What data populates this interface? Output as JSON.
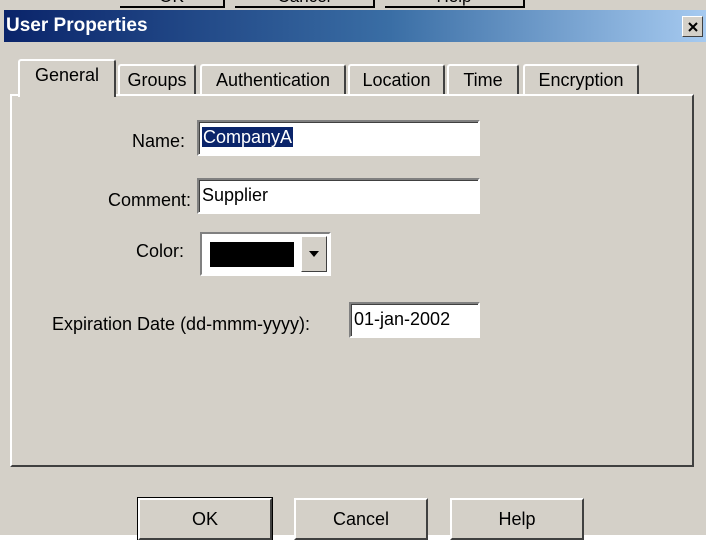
{
  "background_buttons": [
    "OK",
    "Cancel",
    "Help"
  ],
  "window": {
    "title": "User Properties",
    "close_glyph": "close-icon"
  },
  "tabs": [
    {
      "label": "General",
      "active": true
    },
    {
      "label": "Groups",
      "active": false
    },
    {
      "label": "Authentication",
      "active": false
    },
    {
      "label": "Location",
      "active": false
    },
    {
      "label": "Time",
      "active": false
    },
    {
      "label": "Encryption",
      "active": false
    }
  ],
  "form": {
    "name_label": "Name:",
    "name_value": "CompanyA",
    "comment_label": "Comment:",
    "comment_value": "Supplier",
    "color_label": "Color:",
    "color_value": "#000000",
    "expiration_label": "Expiration Date (dd-mmm-yyyy):",
    "expiration_value": "01-jan-2002"
  },
  "buttons": {
    "ok": "OK",
    "cancel": "Cancel",
    "help": "Help"
  },
  "colors": {
    "titlebar_start": "#0a246a",
    "titlebar_end": "#a6caf0",
    "face": "#d4d0c8",
    "selection": "#0a246a"
  }
}
